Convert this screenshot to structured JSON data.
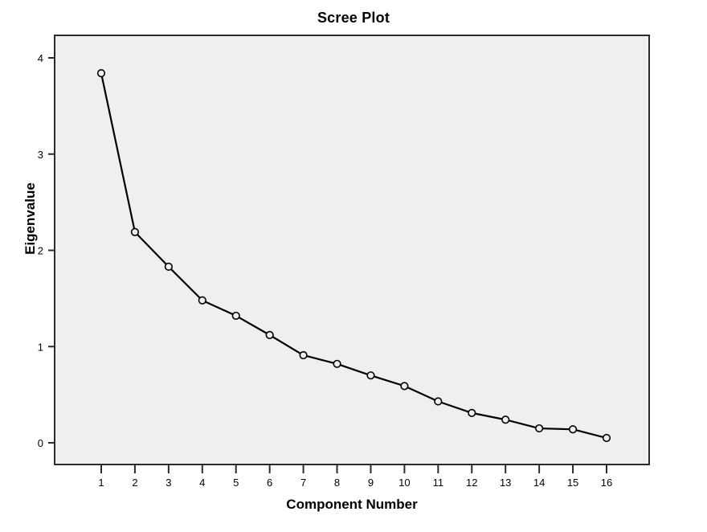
{
  "chart_data": {
    "type": "line",
    "title": "Scree Plot",
    "xlabel": "Component Number",
    "ylabel": "Eigenvalue",
    "x": [
      1,
      2,
      3,
      4,
      5,
      6,
      7,
      8,
      9,
      10,
      11,
      12,
      13,
      14,
      15,
      16
    ],
    "values": [
      3.84,
      2.19,
      1.83,
      1.48,
      1.32,
      1.12,
      0.91,
      0.82,
      0.7,
      0.59,
      0.43,
      0.31,
      0.24,
      0.15,
      0.14,
      0.05
    ],
    "xtick_labels": [
      "1",
      "2",
      "3",
      "4",
      "5",
      "6",
      "7",
      "8",
      "9",
      "10",
      "11",
      "12",
      "13",
      "14",
      "15",
      "16"
    ],
    "ytick_values": [
      0,
      1,
      2,
      3,
      4
    ],
    "ytick_labels": [
      "0",
      "1",
      "2",
      "3",
      "4"
    ],
    "xlim": [
      0.5,
      16.5
    ],
    "ylim": [
      -0.15,
      4.0
    ],
    "grid": false,
    "legend": "none",
    "marker": "open-circle",
    "line_color": "#000000",
    "marker_color": "#000000",
    "plot_background": "#efefef",
    "figure_background": "#ffffff",
    "axis_color": "#2b2b2b"
  }
}
